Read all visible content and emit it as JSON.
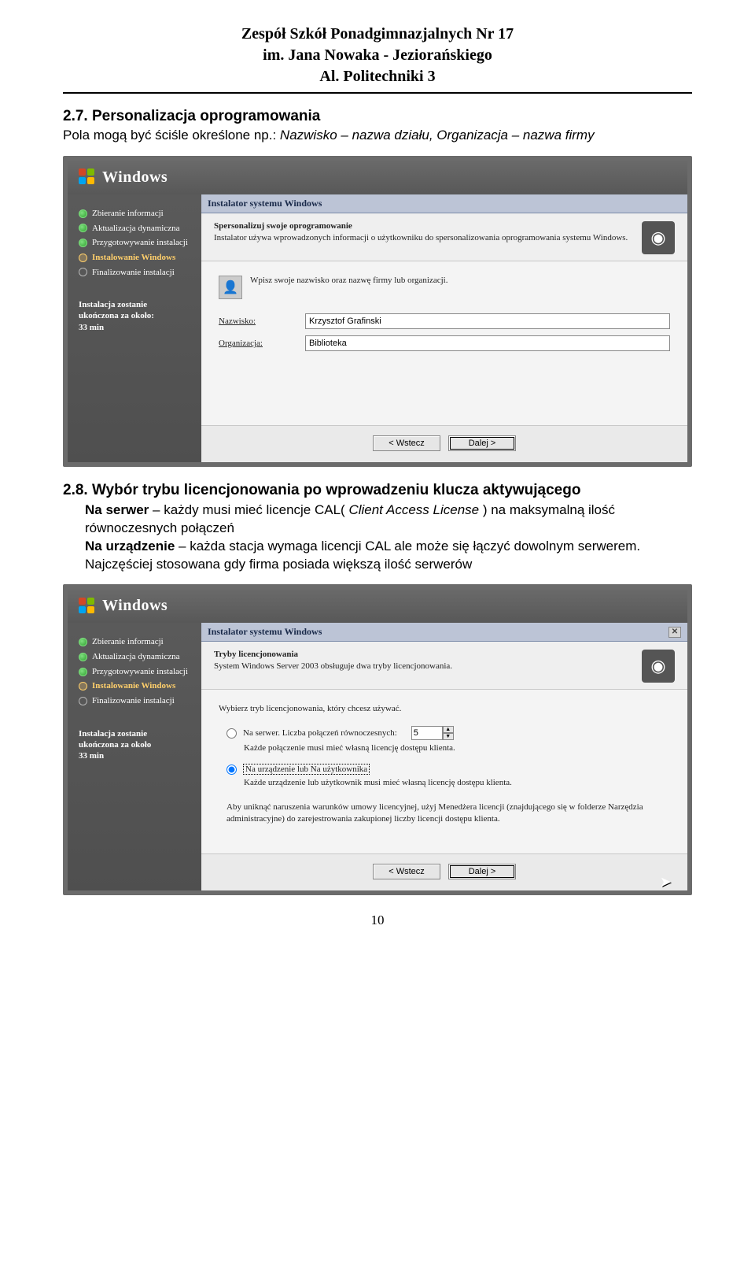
{
  "header": {
    "line1": "Zespół Szkół Ponadgimnazjalnych Nr 17",
    "line2": "im. Jana Nowaka - Jeziorańskiego",
    "line3": "Al. Politechniki 3"
  },
  "section27": {
    "title": "2.7. Personalizacja oprogramowania",
    "p1a": "Pola mogą być ściśle określone np.: ",
    "p1b": "Nazwisko – nazwa działu, Organizacja – nazwa firmy"
  },
  "shot1": {
    "winTitle": "Windows",
    "sidebar": {
      "steps": [
        {
          "label": "Zbieranie informacji",
          "state": "done"
        },
        {
          "label": "Aktualizacja dynamiczna",
          "state": "done"
        },
        {
          "label": "Przygotowywanie instalacji",
          "state": "done"
        },
        {
          "label": "Instalowanie Windows",
          "state": "current"
        },
        {
          "label": "Finalizowanie instalacji",
          "state": "todo"
        }
      ],
      "footer1": "Instalacja zostanie",
      "footer2": "ukończona za około:",
      "footer3": "33 min"
    },
    "dialog": {
      "title": "Instalator systemu Windows",
      "headTitle": "Spersonalizuj swoje oprogramowanie",
      "headText": "Instalator używa wprowadzonych informacji o użytkowniku do spersonalizowania oprogramowania systemu Windows.",
      "intro": "Wpisz swoje nazwisko oraz nazwę firmy lub organizacji.",
      "labelName": "Nazwisko:",
      "valueName": "Krzysztof Grafinski",
      "labelOrg": "Organizacja:",
      "valueOrg": "Biblioteka",
      "btnBack": "< Wstecz",
      "btnNext": "Dalej >"
    }
  },
  "section28": {
    "title": "2.8. Wybór trybu licencjonowania po wprowadzeniu klucza aktywującego",
    "bold1": "Na serwer",
    "t1": " – każdy musi mieć licencje CAL( ",
    "i1": "Client Access License",
    "t1b": ") na maksymalną ilość równoczesnych połączeń",
    "bold2": "Na urządzenie",
    "t2": " – każda stacja wymaga licencji CAL ale może się łączyć dowolnym serwerem. Najczęściej stosowana gdy firma posiada większą ilość serwerów"
  },
  "shot2": {
    "winTitle": "Windows",
    "sidebar": {
      "steps": [
        {
          "label": "Zbieranie informacji",
          "state": "done"
        },
        {
          "label": "Aktualizacja dynamiczna",
          "state": "done"
        },
        {
          "label": "Przygotowywanie instalacji",
          "state": "done"
        },
        {
          "label": "Instalowanie Windows",
          "state": "current"
        },
        {
          "label": "Finalizowanie instalacji",
          "state": "todo"
        }
      ],
      "footer1": "Instalacja zostanie",
      "footer2": "ukończona za około",
      "footer3": "33 min"
    },
    "dialog": {
      "title": "Instalator systemu Windows",
      "headTitle": "Tryby licencjonowania",
      "headText": "System Windows Server 2003 obsługuje dwa tryby licencjonowania.",
      "intro": "Wybierz tryb licencjonowania, który chcesz używać.",
      "radio1": "Na serwer. Liczba połączeń równoczesnych:",
      "spinVal": "5",
      "radio1desc": "Każde połączenie musi mieć własną licencję dostępu klienta.",
      "radio2": "Na urządzenie lub Na użytkownika",
      "radio2desc": "Każde urządzenie lub użytkownik musi mieć własną licencję dostępu klienta.",
      "para": "Aby uniknąć naruszenia warunków umowy licencyjnej, użyj Menedżera licencji (znajdującego się w folderze Narzędzia administracyjne) do zarejestrowania zakupionej liczby licencji dostępu klienta.",
      "btnBack": "< Wstecz",
      "btnNext": "Dalej >"
    }
  },
  "pageNumber": "10"
}
